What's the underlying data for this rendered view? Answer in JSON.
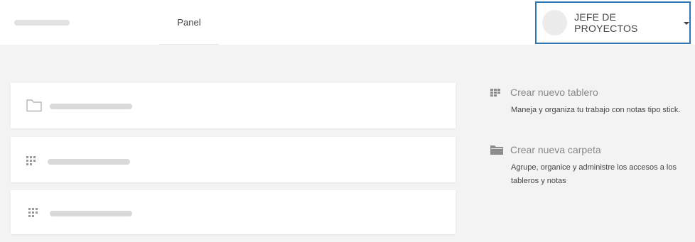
{
  "header": {
    "nav_tab": "Panel",
    "user_name": "JEFE DE PROYECTOS"
  },
  "icons": {
    "folder": "folder-icon",
    "grid": "grid-icon",
    "board": "board-icon",
    "folder_filled": "folder-filled-icon",
    "caret": "caret-down-icon"
  },
  "actions": [
    {
      "title": "Crear nuevo tablero",
      "description": "Maneja y organiza tu trabajo con notas tipo stick."
    },
    {
      "title": "Crear nueva carpeta",
      "description": "Agrupe, organice y administre los accesos a los tableros y notas"
    }
  ],
  "colors": {
    "accent_border": "#2e75b6",
    "background": "#f3f3f3"
  }
}
